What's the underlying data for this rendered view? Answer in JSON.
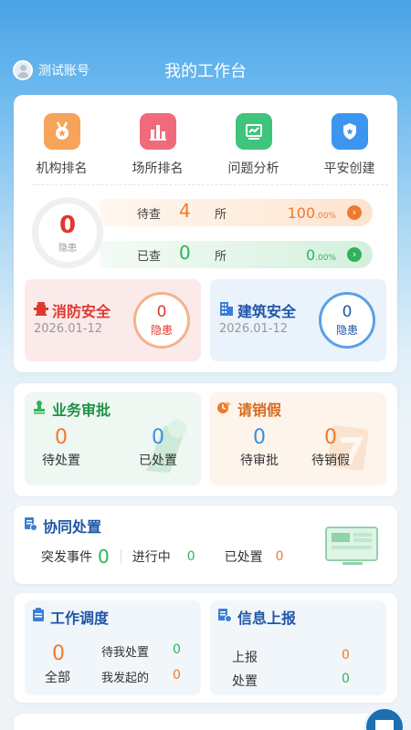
{
  "header": {
    "account": "测试账号",
    "title": "我的工作台"
  },
  "quick_links": [
    {
      "label": "机构排名",
      "icon": "medal-icon",
      "color": "#f5a45a"
    },
    {
      "label": "场所排名",
      "icon": "bar-chart-icon",
      "color": "#f06a7b"
    },
    {
      "label": "问题分析",
      "icon": "trend-chart-icon",
      "color": "#3fc47c"
    },
    {
      "label": "平安创建",
      "icon": "shield-icon",
      "color": "#3c95ee"
    }
  ],
  "hazard": {
    "count": "0",
    "label": "隐患"
  },
  "pending": {
    "label": "待查",
    "count": "4",
    "unit": "所",
    "percent": "100",
    "percent_unit": ".00%"
  },
  "checked": {
    "label": "已查",
    "count": "0",
    "unit": "所",
    "percent": "0",
    "percent_unit": ".00%"
  },
  "fire_safety": {
    "title": "消防安全",
    "date": "2026.01-12",
    "count": "0",
    "label": "隐患"
  },
  "building_safety": {
    "title": "建筑安全",
    "date": "2026.01-12",
    "count": "0",
    "label": "隐患"
  },
  "approval": {
    "title": "业务审批",
    "pending_count": "0",
    "pending_label": "待处置",
    "done_count": "0",
    "done_label": "已处置"
  },
  "leave": {
    "title": "请销假",
    "review_count": "0",
    "review_label": "待审批",
    "cancel_count": "0",
    "cancel_label": "待销假"
  },
  "collab": {
    "title": "协同处置",
    "emergency_label": "突发事件",
    "emergency_count": "0",
    "progress_label": "进行中",
    "progress_count": "0",
    "done_label": "已处置",
    "done_count": "0"
  },
  "schedule": {
    "title": "工作调度",
    "total_count": "0",
    "total_label": "全部",
    "mine_label": "待我处置",
    "mine_count": "0",
    "started_label": "我发起的",
    "started_count": "0"
  },
  "report": {
    "title": "信息上报",
    "report_label": "上报",
    "report_count": "0",
    "handle_label": "处置",
    "handle_count": "0"
  }
}
